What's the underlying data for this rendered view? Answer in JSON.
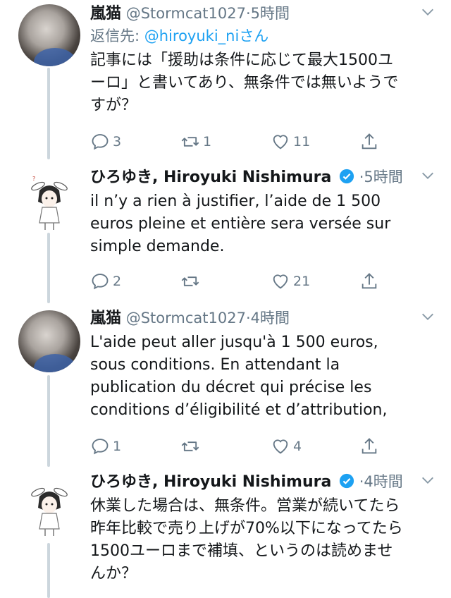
{
  "tweets": [
    {
      "display_name": "嵐猫",
      "handle": "@Stormcat1027",
      "time": "5時間",
      "reply_prefix": "返信先: ",
      "reply_to": "@hiroyuki_ni",
      "reply_suffix": "さん",
      "text": "記事には「援助は条件に応じて最大1500ユ\nーロ」と書いてあり、無条件では無いようで\nすが？",
      "replies": "3",
      "retweets": "1",
      "likes": "11"
    },
    {
      "display_name": "ひろゆき, Hiroyuki Nishimura",
      "handle": "",
      "time": "5時間",
      "text": "il n’y a rien à justifier, l’aide de 1 500\neuros pleine et entière sera versée sur\nsimple demande.",
      "replies": "2",
      "retweets": "",
      "likes": "21"
    },
    {
      "display_name": "嵐猫",
      "handle": "@Stormcat1027",
      "time": "4時間",
      "text": "L'aide peut aller jusqu'à 1 500 euros,\nsous conditions. En attendant la\npublication du décret qui précise les\nconditions d’éligibilité et d’attribution,",
      "replies": "1",
      "retweets": "",
      "likes": "4"
    },
    {
      "display_name": "ひろゆき, Hiroyuki Nishimura",
      "handle": "",
      "time": "4時間",
      "text": "休業した場合は、無条件。営業が続いてたら\n昨年比較で売り上げが70%以下になってたら\n1500ユーロまで補填、というのは読めませ\nんか？"
    }
  ],
  "colors": {
    "accent": "#1da1f2",
    "muted": "#657786",
    "text": "#14171a",
    "line": "#ccd6dd"
  }
}
